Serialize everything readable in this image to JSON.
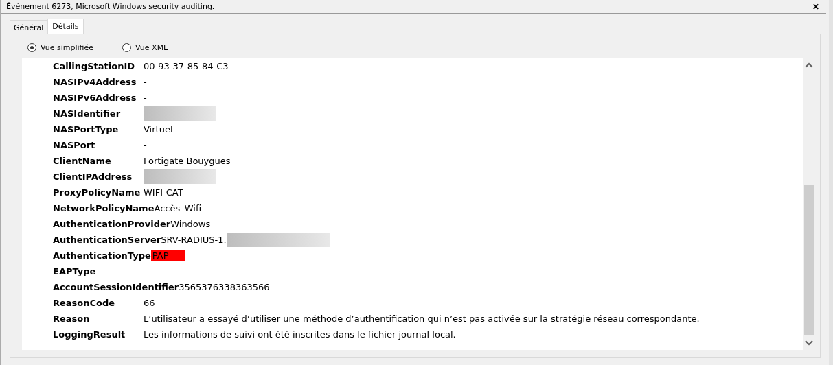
{
  "window": {
    "title": "Événement 6273, Microsoft Windows security auditing.",
    "close": "✕"
  },
  "tabs": [
    {
      "label": "Général",
      "selected": false
    },
    {
      "label": "Détails",
      "selected": true
    }
  ],
  "view_options": [
    {
      "label": "Vue simplifiée",
      "selected": true
    },
    {
      "label": "Vue XML",
      "selected": false
    }
  ],
  "fields": [
    {
      "kind": "plain",
      "name": "CallingStationID",
      "value": "00-93-37-85-84-C3"
    },
    {
      "kind": "plain",
      "name": "NASIPv4Address",
      "value": "-"
    },
    {
      "kind": "plain",
      "name": "NASIPv6Address",
      "value": "-"
    },
    {
      "kind": "redacted",
      "name": "NASIdentifier"
    },
    {
      "kind": "plain",
      "name": "NASPortType",
      "value": "Virtuel"
    },
    {
      "kind": "plain",
      "name": "NASPort",
      "value": "-"
    },
    {
      "kind": "plain",
      "name": "ClientName",
      "value": "Fortigate Bouygues"
    },
    {
      "kind": "redacted",
      "name": "ClientIPAddress"
    },
    {
      "kind": "plain",
      "name": "ProxyPolicyName",
      "value": "WIFI-CAT"
    },
    {
      "kind": "plain",
      "name": "NetworkPolicyName",
      "value": "Accès_Wifi"
    },
    {
      "kind": "plain",
      "name": "AuthenticationProvider",
      "value": "Windows"
    },
    {
      "kind": "partly_redacted",
      "name": "AuthenticationServer",
      "value": "SRV-RADIUS-1."
    },
    {
      "kind": "highlighted",
      "name": "AuthenticationType",
      "value": "PAP"
    },
    {
      "kind": "plain",
      "name": "EAPType",
      "value": "-"
    },
    {
      "kind": "plain",
      "name": "AccountSessionIdentifier",
      "value": "3565376338363566"
    },
    {
      "kind": "plain",
      "name": "ReasonCode",
      "value": "66"
    },
    {
      "kind": "plain",
      "name": "Reason",
      "value": "L’utilisateur a essayé d’utiliser une méthode d’authentification qui n’est pas activée sur la stratégie réseau correspondante."
    },
    {
      "kind": "plain",
      "name": "LoggingResult",
      "value": "Les informations de suivi ont été inscrites dans le fichier journal local."
    }
  ]
}
